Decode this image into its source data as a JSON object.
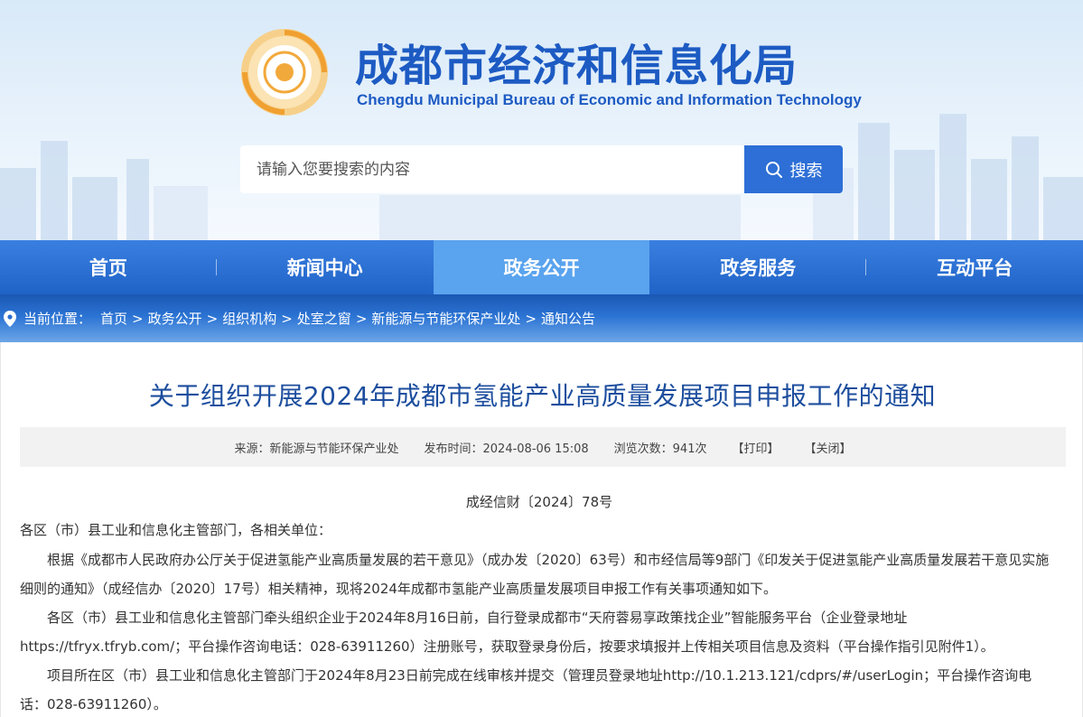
{
  "header": {
    "site_title": "成都市经济和信息化局",
    "site_subtitle": "Chengdu Municipal Bureau of Economic and Information Technology",
    "search_placeholder": "请输入您要搜索的内容",
    "search_button": "搜索"
  },
  "nav": {
    "items": [
      {
        "label": "首页",
        "active": false
      },
      {
        "label": "新闻中心",
        "active": false
      },
      {
        "label": "政务公开",
        "active": true
      },
      {
        "label": "政务服务",
        "active": false
      },
      {
        "label": "互动平台",
        "active": false
      }
    ]
  },
  "breadcrumb": {
    "prefix": "当前位置：",
    "separator": ">",
    "items": [
      "首页",
      "政务公开",
      "组织机构",
      "处室之窗",
      "新能源与节能环保产业处",
      "通知公告"
    ]
  },
  "article": {
    "title": "关于组织开展2024年成都市氢能产业高质量发展项目申报工作的通知",
    "meta": {
      "source": "来源：新能源与节能环保产业处",
      "publish_time": "发布时间：2024-08-06 15:08",
      "views": "浏览次数：941次",
      "print": "【打印】",
      "close": "【关闭】"
    },
    "doc_number": "成经信财〔2024〕78号",
    "salutation": "各区（市）县工业和信息化主管部门，各相关单位：",
    "paragraphs": [
      "根据《成都市人民政府办公厅关于促进氢能产业高质量发展的若干意见》（成办发〔2020〕63号）和市经信局等9部门《印发关于促进氢能产业高质量发展若干意见实施细则的通知》（成经信办〔2020〕17号）相关精神，现将2024年成都市氢能产业高质量发展项目申报工作有关事项通知如下。",
      "各区（市）县工业和信息化主管部门牵头组织企业于2024年8月16日前，自行登录成都市“天府蓉易享政策找企业”智能服务平台（企业登录地址https://tfryx.tfryb.com/；平台操作咨询电话：028-63911260）注册账号，获取登录身份后，按要求填报并上传相关项目信息及资料（平台操作指引见附件1）。",
      "项目所在区（市）县工业和信息化主管部门于2024年8月23日前完成在线审核并提交（管理员登录地址http://10.1.213.121/cdprs/#/userLogin；平台操作咨询电话：028-63911260）。"
    ]
  },
  "colors": {
    "brand_blue": "#1d5bc3",
    "nav_blue": "#2a6fd6",
    "nav_active": "#5aa3ee",
    "title_blue": "#1d4e9e",
    "logo_gold": "#f2a93b"
  },
  "icons": [
    "logo-emblem",
    "search-icon",
    "location-pin-icon"
  ]
}
